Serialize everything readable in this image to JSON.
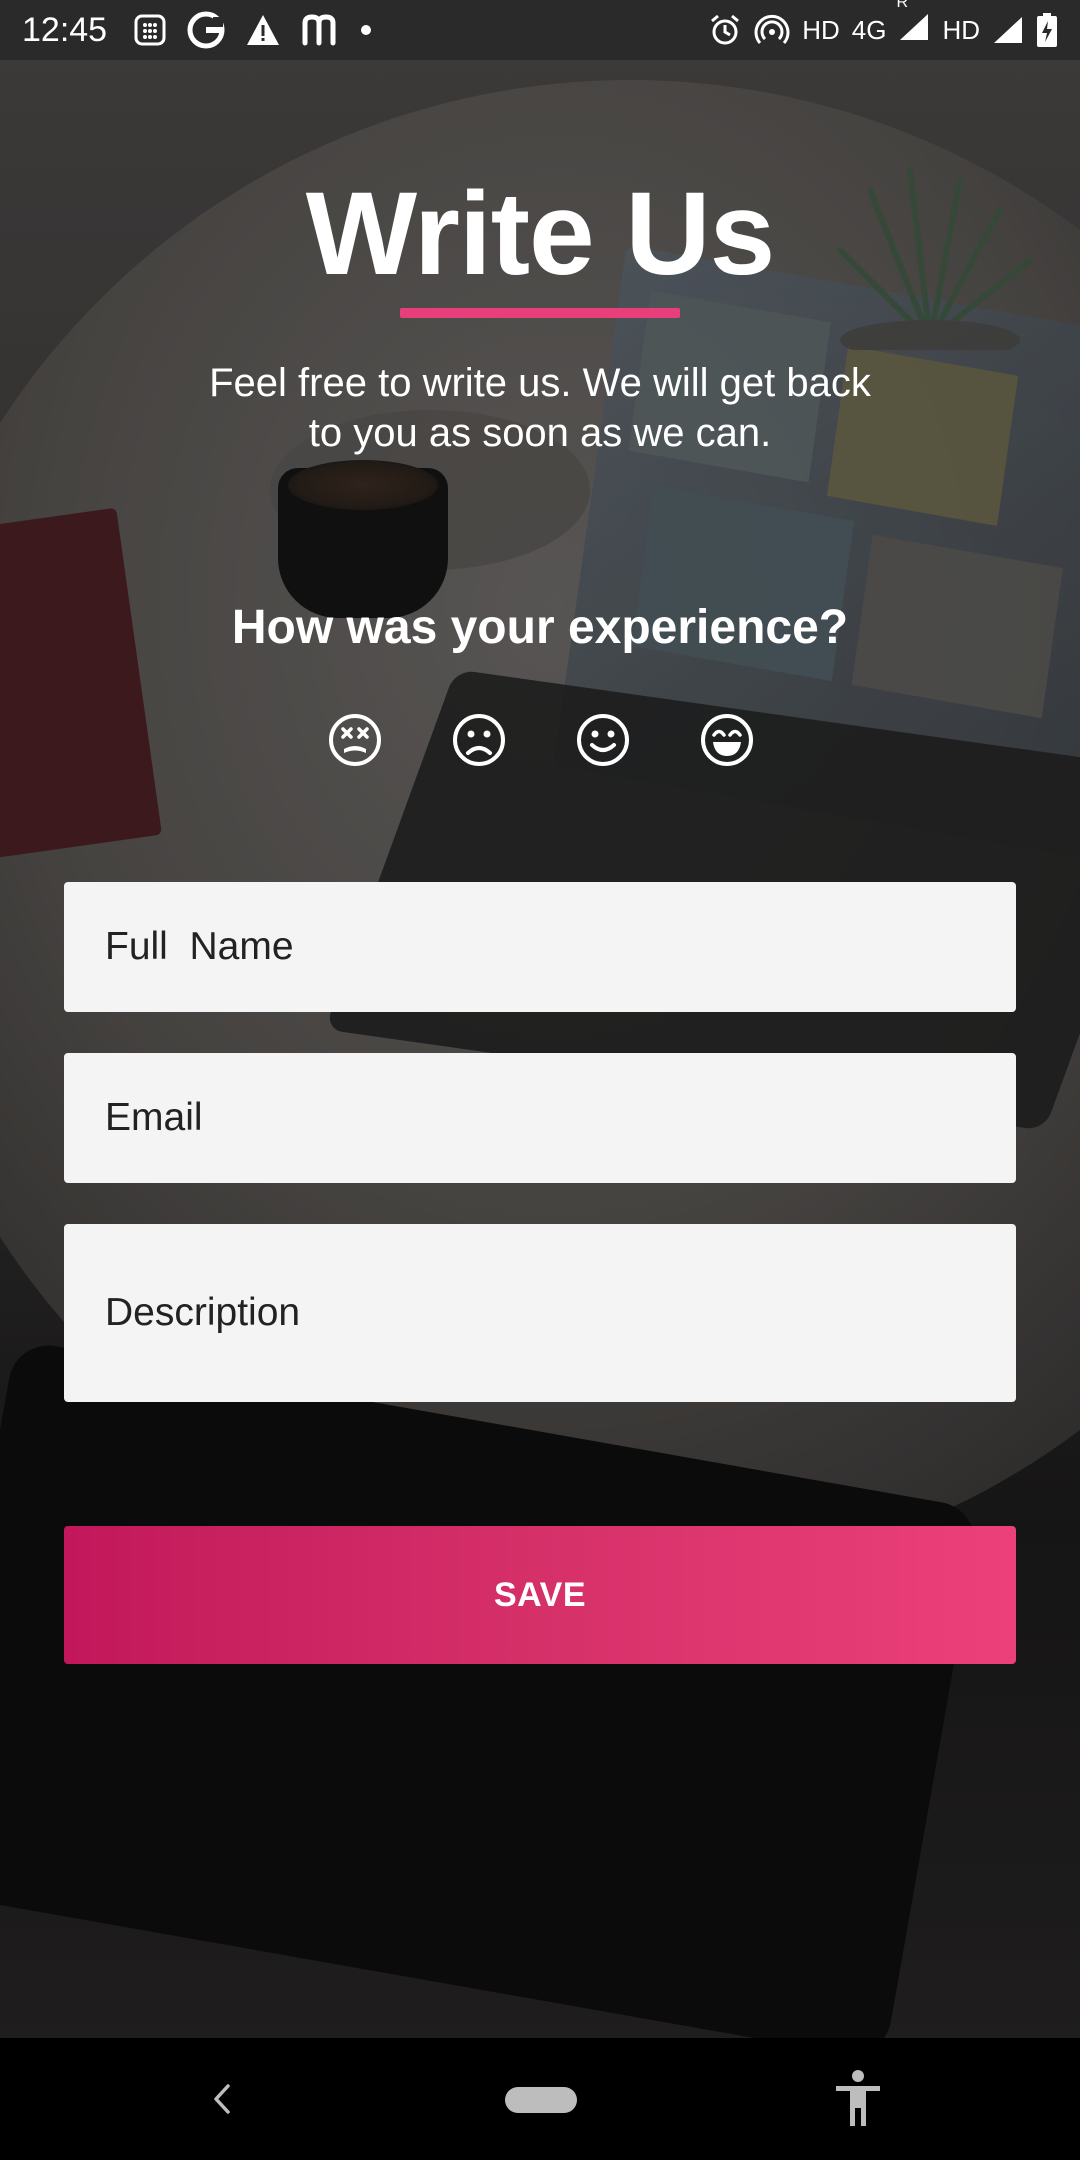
{
  "status_bar": {
    "time": "12:45",
    "left_icons": [
      "calculator-icon",
      "g-icon",
      "warning-icon",
      "m-icon",
      "dot-icon"
    ],
    "network_text_1": "HD",
    "network_text_2": "4G",
    "roaming": "R",
    "network_text_3": "HD",
    "right_icons": [
      "alarm-icon",
      "hotspot-icon",
      "signal-icon",
      "signal-icon",
      "battery-charging-icon"
    ]
  },
  "header": {
    "title": "Write Us",
    "subtitle": "Feel free to write us. We will get back to you as soon as we can."
  },
  "rating": {
    "question": "How was your experience?",
    "options": [
      "dizzy-face-icon",
      "sad-face-icon",
      "smile-face-icon",
      "grin-face-icon"
    ]
  },
  "form": {
    "full_name_placeholder": "Full  Name",
    "email_placeholder": "Email",
    "description_placeholder": "Description",
    "save_label": "SAVE"
  },
  "colors": {
    "accent": "#e83e7a",
    "button_start": "#c2185b",
    "button_end": "#ec407a",
    "field_bg": "#f4f4f4"
  },
  "nav_bar": {
    "icons": [
      "back-icon",
      "home-pill-icon",
      "accessibility-icon"
    ]
  }
}
